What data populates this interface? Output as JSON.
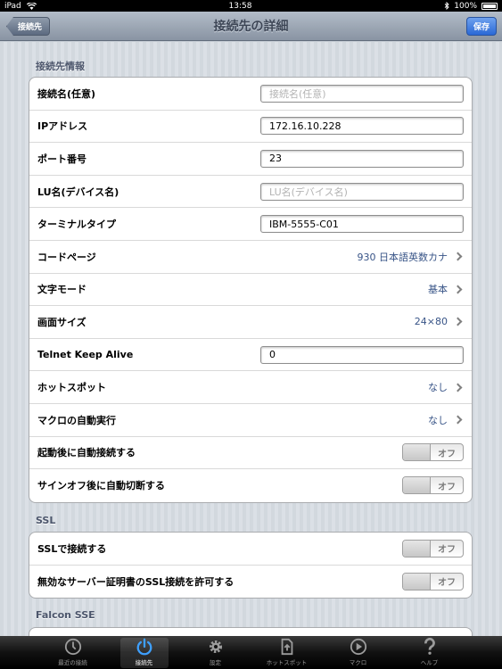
{
  "status_bar": {
    "device": "iPad",
    "time": "13:58",
    "battery": "100%"
  },
  "nav": {
    "back_label": "接続先",
    "title": "接続先の詳細",
    "save_label": "保存"
  },
  "sections": {
    "connection": {
      "header": "接続先情報",
      "rows": [
        {
          "label": "接続名(任意)",
          "type": "input",
          "value": "",
          "placeholder": "接続名(任意)"
        },
        {
          "label": "IPアドレス",
          "type": "input",
          "value": "172.16.10.228",
          "placeholder": ""
        },
        {
          "label": "ポート番号",
          "type": "input",
          "value": "23",
          "placeholder": ""
        },
        {
          "label": "LU名(デバイス名)",
          "type": "input",
          "value": "",
          "placeholder": "LU名(デバイス名)"
        },
        {
          "label": "ターミナルタイプ",
          "type": "input",
          "value": "IBM-5555-C01",
          "placeholder": ""
        },
        {
          "label": "コードページ",
          "type": "disclosure",
          "value": "930 日本語英数カナ"
        },
        {
          "label": "文字モード",
          "type": "disclosure",
          "value": "基本"
        },
        {
          "label": "画面サイズ",
          "type": "disclosure",
          "value": "24×80"
        },
        {
          "label": "Telnet Keep Alive",
          "type": "input",
          "value": "0",
          "placeholder": ""
        },
        {
          "label": "ホットスポット",
          "type": "disclosure",
          "value": "なし"
        },
        {
          "label": "マクロの自動実行",
          "type": "disclosure",
          "value": "なし"
        },
        {
          "label": "起動後に自動接続する",
          "type": "switch",
          "value": "オフ"
        },
        {
          "label": "サインオフ後に自動切断する",
          "type": "switch",
          "value": "オフ"
        }
      ]
    },
    "ssl": {
      "header": "SSL",
      "rows": [
        {
          "label": "SSLで接続する",
          "type": "switch",
          "value": "オフ"
        },
        {
          "label": "無効なサーバー証明書のSSL接続を許可する",
          "type": "switch",
          "value": "オフ"
        }
      ]
    },
    "falcon": {
      "header": "Falcon SSE"
    }
  },
  "tabs": [
    {
      "label": "最近の接続",
      "icon": "clock-icon",
      "active": false
    },
    {
      "label": "接続先",
      "icon": "power-icon",
      "active": true
    },
    {
      "label": "設定",
      "icon": "gear-icon",
      "active": false
    },
    {
      "label": "ホットスポット",
      "icon": "hotspot-icon",
      "active": false
    },
    {
      "label": "マクロ",
      "icon": "play-icon",
      "active": false
    },
    {
      "label": "ヘルプ",
      "icon": "help-icon",
      "active": false
    }
  ]
}
